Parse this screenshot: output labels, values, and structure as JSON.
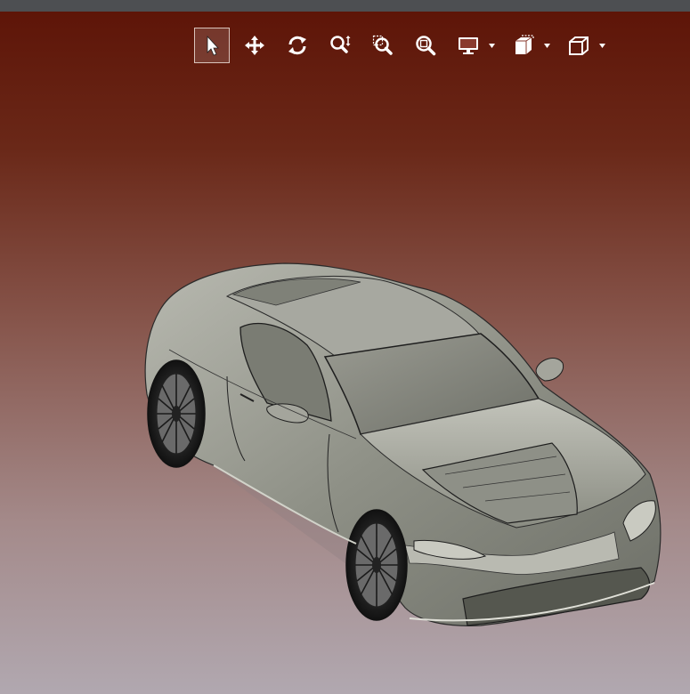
{
  "app": {
    "viewport_background_top": "#5e1508",
    "viewport_background_bottom": "#b1a8b0",
    "model_color": "#9c9e94"
  },
  "toolbar": {
    "tools": [
      {
        "name": "select-tool",
        "icon": "cursor-arrow-icon",
        "active": true
      },
      {
        "name": "pan-tool",
        "icon": "move-arrows-icon",
        "active": false
      },
      {
        "name": "rotate-tool",
        "icon": "rotate-icon",
        "active": false
      },
      {
        "name": "zoom-tool",
        "icon": "zoom-vertical-icon",
        "active": false
      },
      {
        "name": "zoom-window-tool",
        "icon": "zoom-window-icon",
        "active": false
      },
      {
        "name": "zoom-fit-tool",
        "icon": "zoom-fit-icon",
        "active": false
      },
      {
        "name": "display-mode-tool",
        "icon": "monitor-icon",
        "active": false,
        "dropdown": true
      },
      {
        "name": "section-view-tool",
        "icon": "section-cube-icon",
        "active": false,
        "dropdown": true
      },
      {
        "name": "view-orientation-tool",
        "icon": "cube-icon",
        "active": false,
        "dropdown": true
      }
    ]
  }
}
